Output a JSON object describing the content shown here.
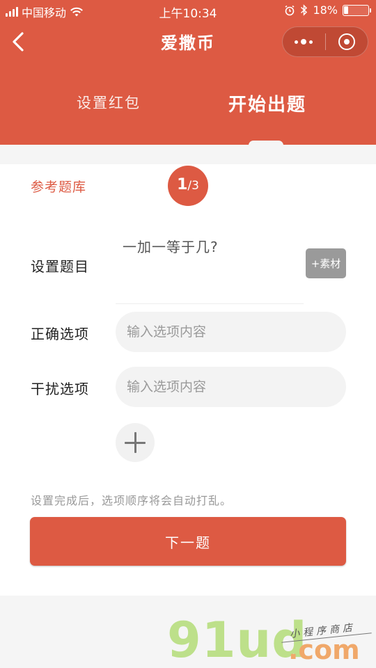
{
  "status_bar": {
    "carrier": "中国移动",
    "time": "上午10:34",
    "battery_percent": "18%",
    "battery_level": 0.18
  },
  "nav": {
    "title": "爱撒币",
    "back_icon": "chevron-left-icon",
    "more_icon": "more-dots-icon",
    "close_icon": "target-circle-icon"
  },
  "tabs": [
    {
      "label": "设置红包",
      "active": false
    },
    {
      "label": "开始出题",
      "active": true
    }
  ],
  "question_card": {
    "reference_bank": "参考题库",
    "page_current": "1",
    "page_total": "/3",
    "question_label": "设置题目",
    "question_text": "一加一等于几?",
    "material_button": "+素材",
    "correct_label": "正确选项",
    "correct_placeholder": "输入选项内容",
    "correct_value": "",
    "distractor_label": "干扰选项",
    "distractor_placeholder": "输入选项内容",
    "distractor_value": "",
    "hint": "设置完成后，选项顺序将会自动打乱。",
    "next_button": "下一题"
  },
  "watermark": {
    "main": "91ud",
    "domain": ".com",
    "tagline": "小程序商店"
  },
  "colors": {
    "brand": "#dd5a43",
    "input_bg": "#f3f3f3",
    "material_button": "#9a9a9a"
  }
}
